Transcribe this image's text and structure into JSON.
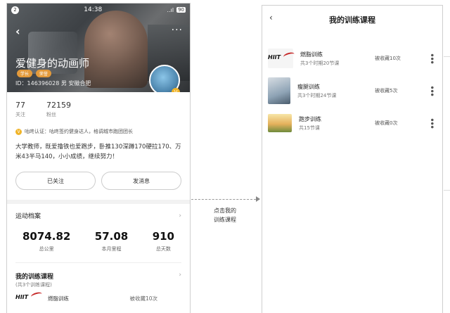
{
  "left": {
    "status": {
      "badge": "2",
      "time": "14:38",
      "signal": "..ıl",
      "battery": "90"
    },
    "hero": {
      "name": "爱健身的动画师",
      "tags": [
        "学长",
        "荣誉"
      ],
      "id_line": "ID：146396028  男  安徽合肥"
    },
    "stats": [
      {
        "num": "77",
        "label": "关注"
      },
      {
        "num": "72159",
        "label": "粉丝"
      }
    ],
    "verify": "咕咚认证：咕咚签约健身达人，格调城市跑团团长",
    "bio": "大学教师，既爱撸铁也爱跑步，卧推130深蹲170硬拉170、万米43半马140，小小成绩，继续努力！",
    "buttons": {
      "follow": "已关注",
      "message": "发消息"
    },
    "sport": {
      "title": "运动档案",
      "items": [
        {
          "value": "8074.82",
          "label": "总公里"
        },
        {
          "value": "57.08",
          "label": "本月里程"
        },
        {
          "value": "910",
          "label": "总天数"
        }
      ]
    },
    "courses": {
      "title": "我的训练课程",
      "subtitle": "(共3个训练课程)",
      "peek": {
        "logo": "HIIT",
        "title": "燃脂训练",
        "fav": "被收藏10次"
      }
    }
  },
  "arrow": {
    "label_line1": "点击我的",
    "label_line2": "训练课程"
  },
  "right": {
    "title": "我的训练课程",
    "items": [
      {
        "title": "燃脂训练",
        "sub": "共3个时期20节课",
        "fav": "被收藏10次",
        "logo": "HIIT"
      },
      {
        "title": "瘦腿训练",
        "sub": "共3个时期24节课",
        "fav": "被收藏5次"
      },
      {
        "title": "跑步训练",
        "sub": "共15节课",
        "fav": "被收藏0次"
      }
    ]
  },
  "icons": {
    "back": "chevron-left-icon",
    "more": "more-dots-icon",
    "chevron": "chevron-right-icon"
  },
  "colors": {
    "tag": "#e39a3b",
    "verify": "#f0b429",
    "hiit_red": "#c62828"
  }
}
